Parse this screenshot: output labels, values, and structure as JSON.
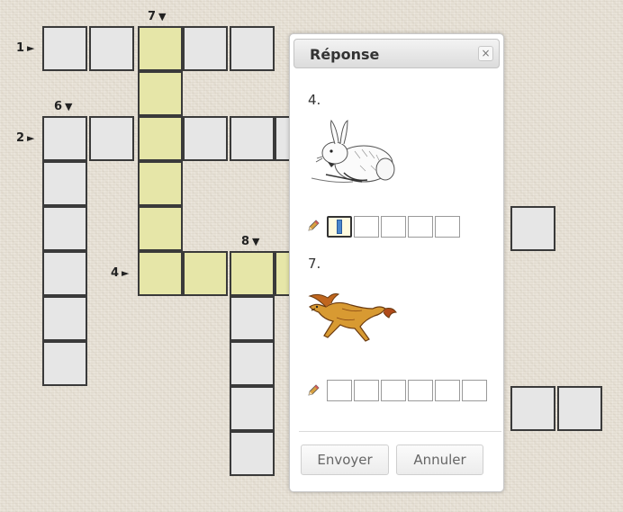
{
  "clues": [
    {
      "number": "1",
      "arrow": "►"
    },
    {
      "number": "7",
      "arrow": "▼"
    },
    {
      "number": "6",
      "arrow": "▼"
    },
    {
      "number": "2",
      "arrow": "►"
    },
    {
      "number": "8",
      "arrow": "▼"
    },
    {
      "number": "4",
      "arrow": "►"
    }
  ],
  "dialog": {
    "title": "Réponse",
    "close": "×",
    "questions": [
      {
        "number": "4.",
        "picture": "rabbit",
        "letters": 5,
        "active_index": 0
      },
      {
        "number": "7.",
        "picture": "horse",
        "letters": 6,
        "active_index": -1
      }
    ],
    "send_label": "Envoyer",
    "cancel_label": "Annuler"
  },
  "colors": {
    "cell": "#e6e6e6",
    "highlight": "#e6e6a8",
    "background": "#e7e1d6"
  }
}
